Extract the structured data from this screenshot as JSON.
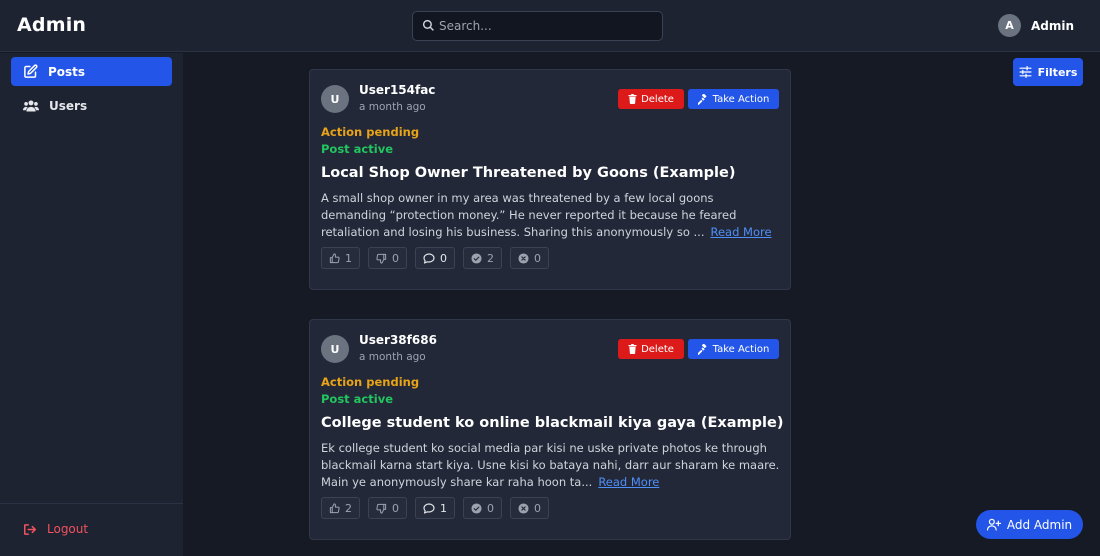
{
  "header": {
    "brand": "Admin",
    "search_placeholder": "Search...",
    "user_initial": "A",
    "user_name": "Admin"
  },
  "sidebar": {
    "items": [
      {
        "label": "Posts",
        "icon": "edit-icon",
        "active": true
      },
      {
        "label": "Users",
        "icon": "users-icon",
        "active": false
      }
    ],
    "logout_label": "Logout"
  },
  "toolbar": {
    "filters_label": "Filters",
    "add_admin_label": "Add Admin"
  },
  "posts": [
    {
      "avatar_initial": "U",
      "username": "User154fac",
      "time": "a month ago",
      "delete_label": "Delete",
      "action_label": "Take Action",
      "status_action": "Action pending",
      "status_post": "Post active",
      "title": "Local Shop Owner Threatened by Goons (Example)",
      "body_lines": [
        "A small shop owner in my area was threatened by a few local goons",
        "demanding “protection money.” He never reported it because he feared",
        "retaliation and losing his business. Sharing this anonymously so ..."
      ],
      "read_more": "Read More",
      "stats": {
        "likes": "1",
        "dislikes": "0",
        "comments": "0",
        "approved": "2",
        "rejected": "0"
      }
    },
    {
      "avatar_initial": "U",
      "username": "User38f686",
      "time": "a month ago",
      "delete_label": "Delete",
      "action_label": "Take Action",
      "status_action": "Action pending",
      "status_post": "Post active",
      "title": "College student ko online blackmail kiya gaya (Example)",
      "body_lines": [
        "Ek college student ko social media par kisi ne uske private photos ke through",
        "blackmail karna start kiya. Usne kisi ko bataya nahi, darr aur sharam ke maare.",
        "Main ye anonymously share kar raha hoon ta..."
      ],
      "read_more": "Read More",
      "stats": {
        "likes": "2",
        "dislikes": "0",
        "comments": "1",
        "approved": "0",
        "rejected": "0"
      }
    }
  ],
  "colors": {
    "accent": "#2356e8",
    "danger": "#dc1a1a",
    "pending": "#e8a317",
    "active": "#22c55e",
    "link": "#4f8ff7"
  }
}
